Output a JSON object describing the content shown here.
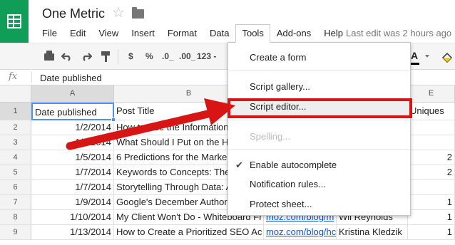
{
  "app": {
    "icon_name": "sheets-logo-icon",
    "doc_title": "One Metric",
    "last_edit": "Last edit was 2 hours ago",
    "brand_color": "#0f9d58"
  },
  "menu": {
    "items": [
      {
        "label": "File",
        "active": false
      },
      {
        "label": "Edit",
        "active": false
      },
      {
        "label": "View",
        "active": false
      },
      {
        "label": "Insert",
        "active": false
      },
      {
        "label": "Format",
        "active": false
      },
      {
        "label": "Data",
        "active": false
      },
      {
        "label": "Tools",
        "active": true
      },
      {
        "label": "Add-ons",
        "active": false
      },
      {
        "label": "Help",
        "active": false
      }
    ]
  },
  "toolbar": {
    "currency": "$",
    "percent": "%",
    "decrease_decimals": ".0_",
    "increase_decimals": ".00_",
    "more_formats": "123 -",
    "text_color_label": "A",
    "icons": [
      "print-icon",
      "undo-icon",
      "redo-icon",
      "paint-format-icon",
      "text-color-icon",
      "fill-color-icon"
    ]
  },
  "formula_bar": {
    "fx_label": "fx",
    "value": "Date published"
  },
  "grid": {
    "columns": [
      "A",
      "B",
      "E"
    ],
    "selected_column": "A",
    "rows": [
      {
        "num": "1",
        "date": "Date published",
        "title": "Post Title",
        "url": "",
        "author": "",
        "uniques": "Uniques"
      },
      {
        "num": "2",
        "date": "1/2/2014",
        "title": "How to Use the Information",
        "url": "",
        "author": "",
        "uniques": ""
      },
      {
        "num": "3",
        "date": "1/3/2014",
        "title": "What Should I Put on the H",
        "url": "",
        "author": "",
        "uniques": ""
      },
      {
        "num": "4",
        "date": "1/5/2014",
        "title": "6 Predictions for the Marke",
        "url": "",
        "author": "",
        "uniques": "2"
      },
      {
        "num": "5",
        "date": "1/7/2014",
        "title": "Keywords to Concepts: The",
        "url": "",
        "author": "",
        "uniques": "2"
      },
      {
        "num": "6",
        "date": "1/7/2014",
        "title": "Storytelling Through Data: A",
        "url": "",
        "author": "",
        "uniques": ""
      },
      {
        "num": "7",
        "date": "1/9/2014",
        "title": "Google's December Author",
        "url": "",
        "author": "",
        "uniques": "1"
      },
      {
        "num": "8",
        "date": "1/10/2014",
        "title": "My Client Won't Do - Whiteboard Fr",
        "url": "moz.com/blog/m",
        "author": "Wil Reynolds",
        "uniques": "1"
      },
      {
        "num": "9",
        "date": "1/13/2014",
        "title": "How to Create a Prioritized SEO Ac",
        "url": "moz.com/blog/hc",
        "author": "Kristina Kledzik",
        "uniques": "1"
      }
    ]
  },
  "tools_menu": {
    "items": [
      {
        "label": "Create a form",
        "disabled": false,
        "checked": false,
        "hover": false
      },
      {
        "label": "Script gallery...",
        "disabled": false,
        "checked": false,
        "hover": false
      },
      {
        "label": "Script editor...",
        "disabled": false,
        "checked": false,
        "hover": true
      },
      {
        "label": "Spelling...",
        "disabled": true,
        "checked": false,
        "hover": false
      },
      {
        "label": "Enable autocomplete",
        "disabled": false,
        "checked": true,
        "hover": false
      },
      {
        "label": "Notification rules...",
        "disabled": false,
        "checked": false,
        "hover": false
      },
      {
        "label": "Protect sheet...",
        "disabled": false,
        "checked": false,
        "hover": false
      }
    ],
    "highlighted_item": "Script editor...",
    "annotation_color": "#d81515",
    "check_mark": "✔"
  }
}
